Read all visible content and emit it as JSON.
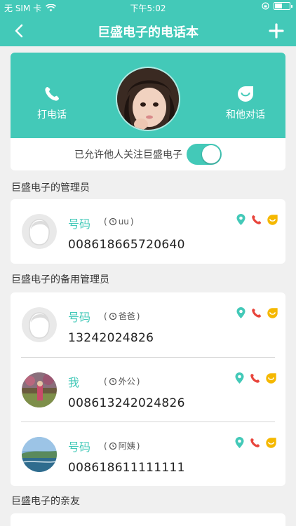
{
  "status": {
    "carrier": "无 SIM 卡",
    "time": "下午5:02"
  },
  "nav": {
    "title": "巨盛电子的电话本"
  },
  "profile": {
    "call_label": "打电话",
    "chat_label": "和他对话",
    "follow_label": "已允许他人关注巨盛电子",
    "follow_enabled": true
  },
  "sections": {
    "admin": "巨盛电子的管理员",
    "backup": "巨盛电子的备用管理员",
    "friends": "巨盛电子的亲友"
  },
  "admin_contacts": [
    {
      "name": "号码",
      "tag": "uu",
      "number": "008618665720640"
    }
  ],
  "backup_contacts": [
    {
      "name": "号码",
      "tag": "爸爸",
      "number": "13242024826"
    },
    {
      "name": "我",
      "tag": "外公",
      "number": "008613242024826"
    },
    {
      "name": "号码",
      "tag": "阿姨",
      "number": "008618611111111"
    }
  ],
  "colors": {
    "accent": "#43c9b8",
    "call_red": "#e8453c",
    "chat_yellow": "#f5b800"
  }
}
